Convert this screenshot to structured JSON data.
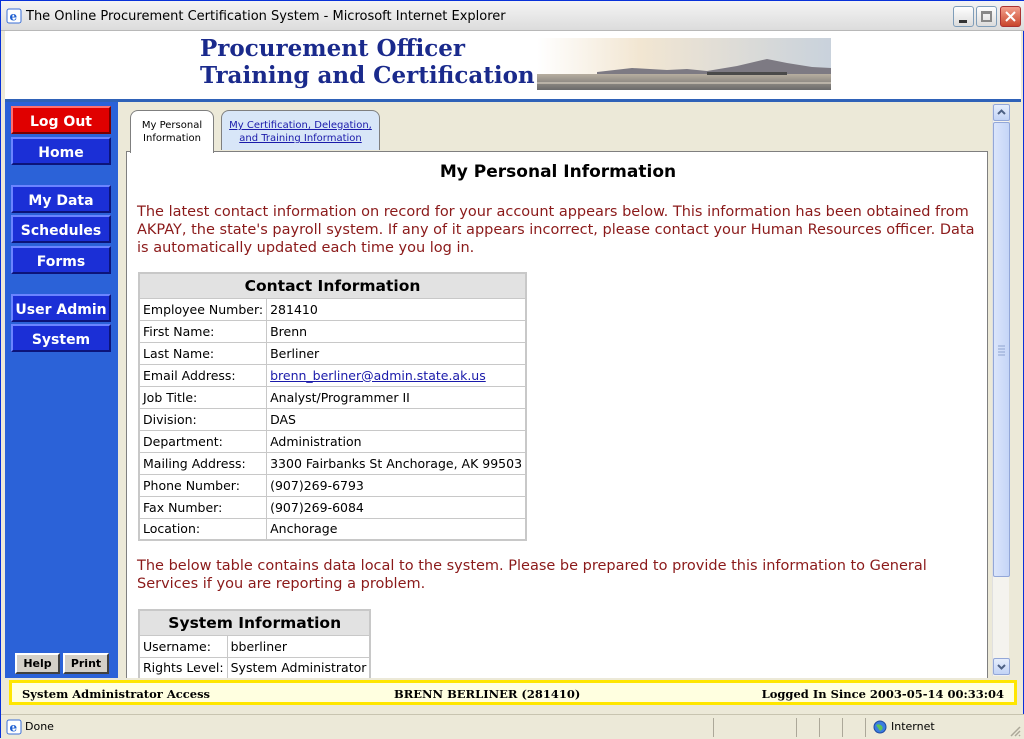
{
  "window": {
    "title": "The Online Procurement Certification System - Microsoft Internet Explorer"
  },
  "banner": {
    "line1": "Procurement Officer",
    "line2": "Training and Certification"
  },
  "sidebar": {
    "logout": "Log Out",
    "home": "Home",
    "my_data": "My Data",
    "schedules": "Schedules",
    "forms": "Forms",
    "user_admin": "User Admin",
    "system": "System",
    "help": "Help",
    "print": "Print"
  },
  "tabs": {
    "personal_line1": "My Personal",
    "personal_line2": "Information",
    "cert_line1": "My Certification, Delegation,",
    "cert_line2": "and Training Information"
  },
  "main": {
    "title": "My Personal Information",
    "intro": "The latest contact information on record for your account appears below. This information has been obtained from AKPAY, the state's payroll system. If any of it appears incorrect, please contact your Human Resources officer. Data is automatically updated each time you log in.",
    "local_note": "The below table contains data local to the system. Please be prepared to provide this information to General Services if you are reporting a problem."
  },
  "contact": {
    "header": "Contact Information",
    "rows": [
      {
        "label": "Employee Number:",
        "value": "281410"
      },
      {
        "label": "First Name:",
        "value": "Brenn"
      },
      {
        "label": "Last Name:",
        "value": "Berliner"
      },
      {
        "label": "Email Address:",
        "value": "brenn_berliner@admin.state.ak.us"
      },
      {
        "label": "Job Title:",
        "value": "Analyst/Programmer II"
      },
      {
        "label": "Division:",
        "value": "DAS"
      },
      {
        "label": "Department:",
        "value": "Administration"
      },
      {
        "label": "Mailing Address:",
        "value": "3300 Fairbanks St Anchorage, AK 99503"
      },
      {
        "label": "Phone Number:",
        "value": "(907)269-6793"
      },
      {
        "label": "Fax Number:",
        "value": "(907)269-6084"
      },
      {
        "label": "Location:",
        "value": "Anchorage"
      }
    ]
  },
  "system_info": {
    "header": "System Information",
    "rows": [
      {
        "label": "Username:",
        "value": "bberliner"
      },
      {
        "label": "Rights Level:",
        "value": "System Administrator"
      }
    ]
  },
  "sysbar": {
    "access": "System Administrator Access",
    "user": "BRENN BERLINER (281410)",
    "logged_in": "Logged In Since 2003-05-14 00:33:04"
  },
  "statusbar": {
    "status": "Done",
    "zone": "Internet"
  }
}
